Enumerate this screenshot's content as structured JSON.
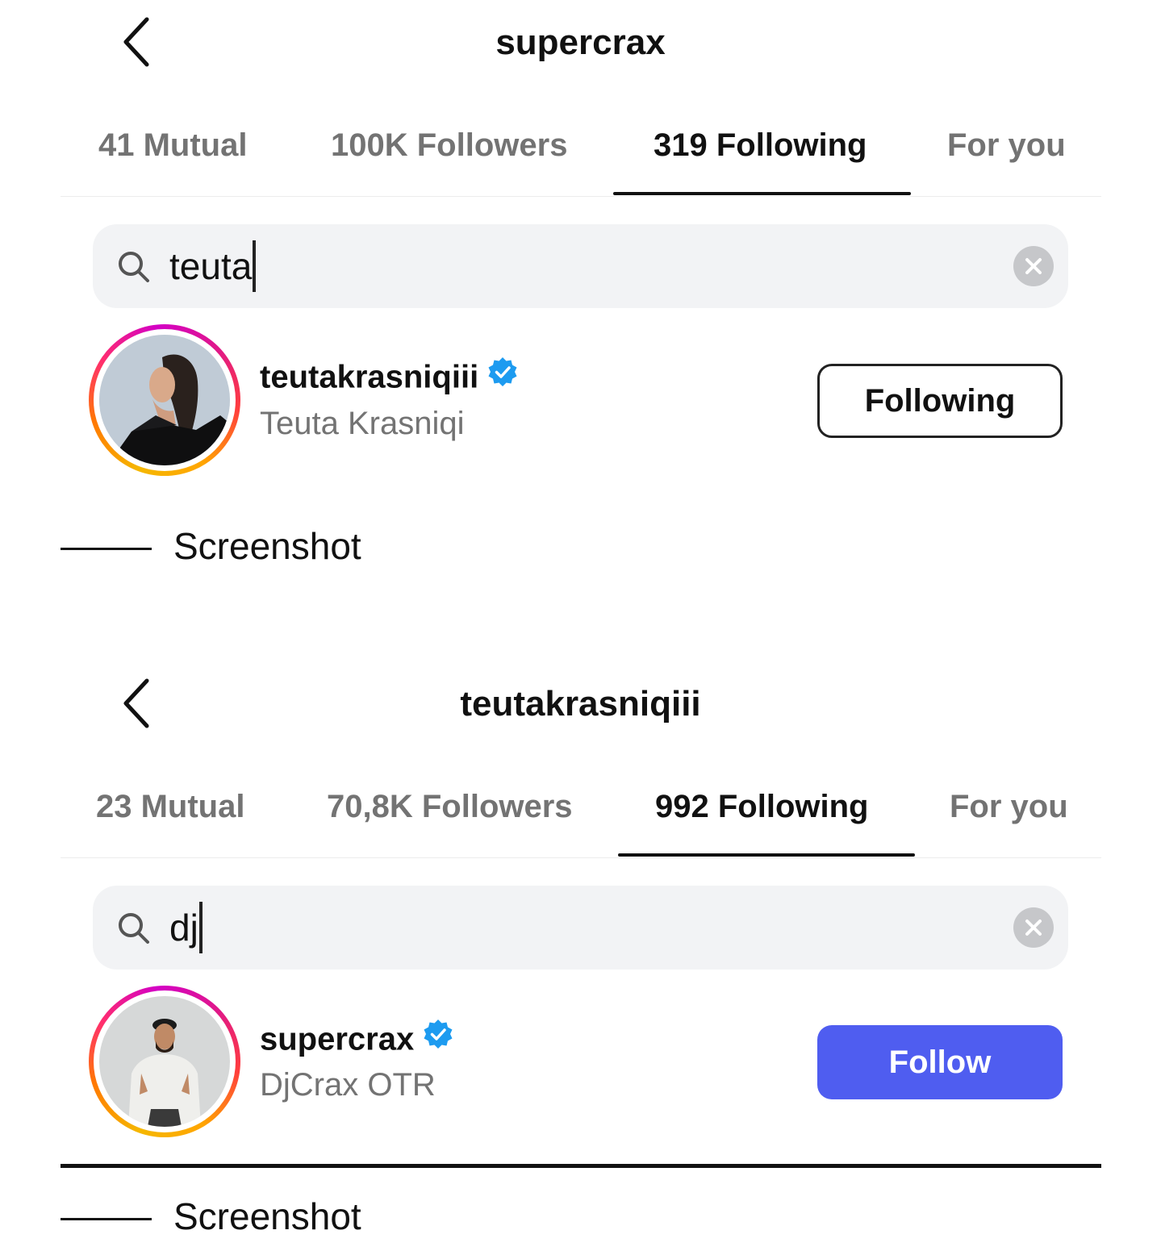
{
  "screens": [
    {
      "title": "supercrax",
      "tabs": [
        {
          "label": "41 Mutual",
          "active": false
        },
        {
          "label": "100K Followers",
          "active": false
        },
        {
          "label": "319 Following",
          "active": true
        },
        {
          "label": "For you",
          "active": false
        }
      ],
      "search": {
        "value": "teuta"
      },
      "result": {
        "username": "teutakrasniqiii",
        "verified": true,
        "full_name": "Teuta Krasniqi",
        "button_label": "Following",
        "button_style": "outline"
      },
      "caption": "Screenshot"
    },
    {
      "title": "teutakrasniqiii",
      "tabs": [
        {
          "label": "23 Mutual",
          "active": false
        },
        {
          "label": "70,8K Followers",
          "active": false
        },
        {
          "label": "992 Following",
          "active": true
        },
        {
          "label": "For you",
          "active": false
        }
      ],
      "search": {
        "value": "dj"
      },
      "result": {
        "username": "supercrax",
        "verified": true,
        "full_name": "DjCrax OTR",
        "button_label": "Follow",
        "button_style": "primary"
      },
      "caption": "Screenshot"
    }
  ],
  "colors": {
    "follow_button": "#4f5df0",
    "verified_badge": "#1d9bf0",
    "secondary_text": "#737373",
    "search_bg": "#f2f3f5"
  },
  "icons": [
    "back-arrow-icon",
    "search-icon",
    "clear-icon",
    "verified-badge-icon"
  ]
}
